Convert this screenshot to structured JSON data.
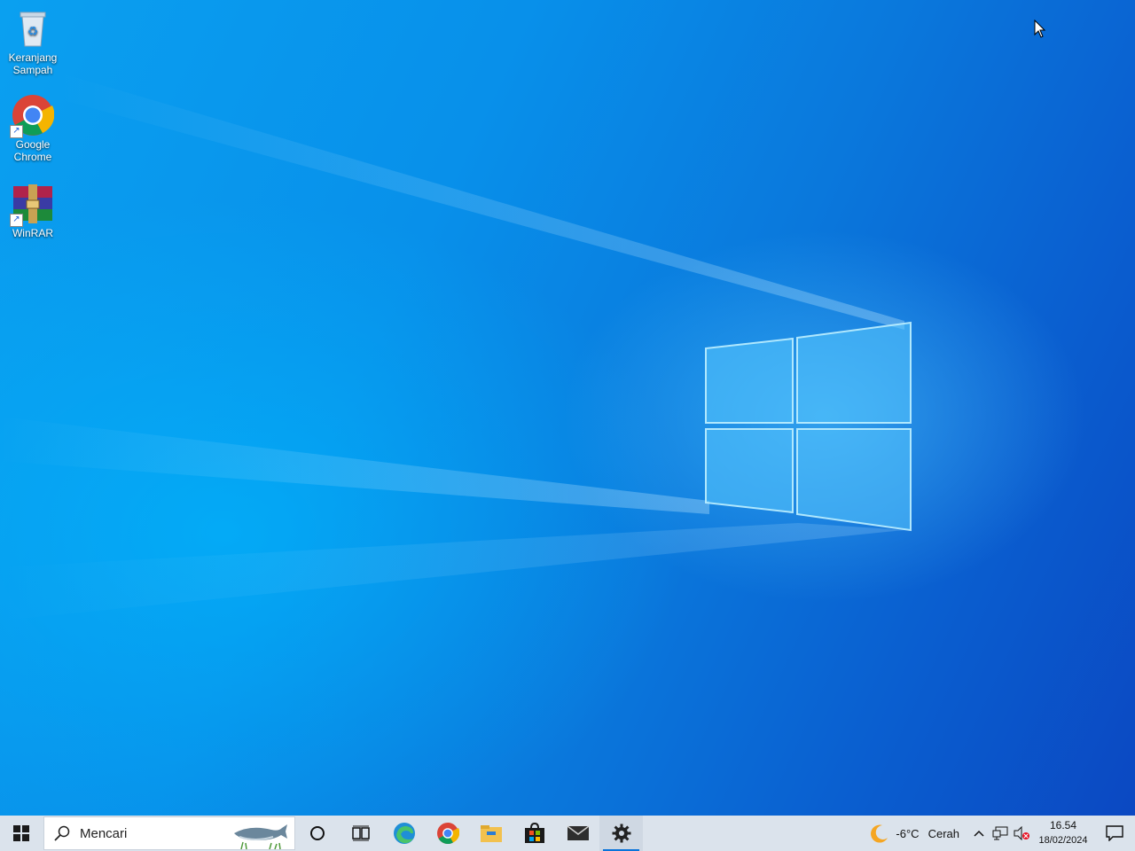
{
  "desktop": {
    "icons": [
      {
        "label": "Keranjang\nSampah",
        "icon": "recycle-bin-icon"
      },
      {
        "label": "Google\nChrome",
        "icon": "chrome-icon"
      },
      {
        "label": "WinRAR",
        "icon": "winrar-icon"
      }
    ]
  },
  "taskbar": {
    "search": {
      "placeholder": "Mencari"
    },
    "apps": [
      "cortana-icon",
      "task-view-icon",
      "edge-icon",
      "chrome-icon",
      "file-explorer-icon",
      "microsoft-store-icon",
      "mail-icon",
      "settings-icon"
    ],
    "active_app": "settings-icon",
    "weather": {
      "temp": "-6°C",
      "condition": "Cerah",
      "icon": "moon-icon"
    },
    "clock": {
      "time": "16.54",
      "date": "18/02/2024"
    }
  },
  "colors": {
    "taskbar_bg": "#dbe3ec",
    "accent": "#0a74da"
  }
}
